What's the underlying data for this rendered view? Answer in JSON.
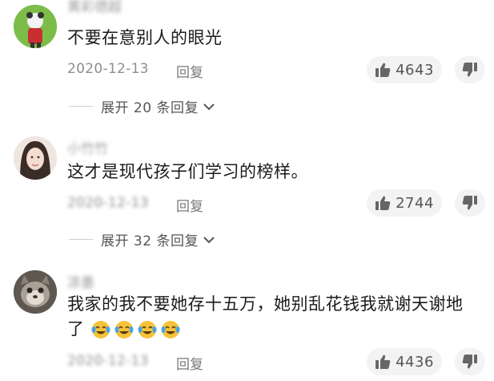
{
  "comments": [
    {
      "username": "黄彩德超",
      "text": "不要在意别人的眼光",
      "date": "2020-12-13",
      "reply_label": "回复",
      "likes": "4643",
      "expand_label": "展开 20 条回复"
    },
    {
      "username": "小竹竹",
      "text": "这才是现代孩子们学习的榜样。",
      "date": "2020-12-13",
      "reply_label": "回复",
      "likes": "2744",
      "expand_label": "展开 32 条回复"
    },
    {
      "username": "凉墨",
      "text": "我家的我不要她存十五万，她别乱花钱我就谢天谢地了",
      "date": "2020-12-13",
      "reply_label": "回复",
      "likes": "4436"
    }
  ],
  "icons": {
    "like": "thumbs-up-icon",
    "dislike": "thumbs-down-icon",
    "expand": "chevron-down-icon",
    "emoji": "tears-of-joy-emoji"
  },
  "colors": {
    "like_pill_bg": "#f3f3f3",
    "meta_text": "#8e8e8e"
  }
}
